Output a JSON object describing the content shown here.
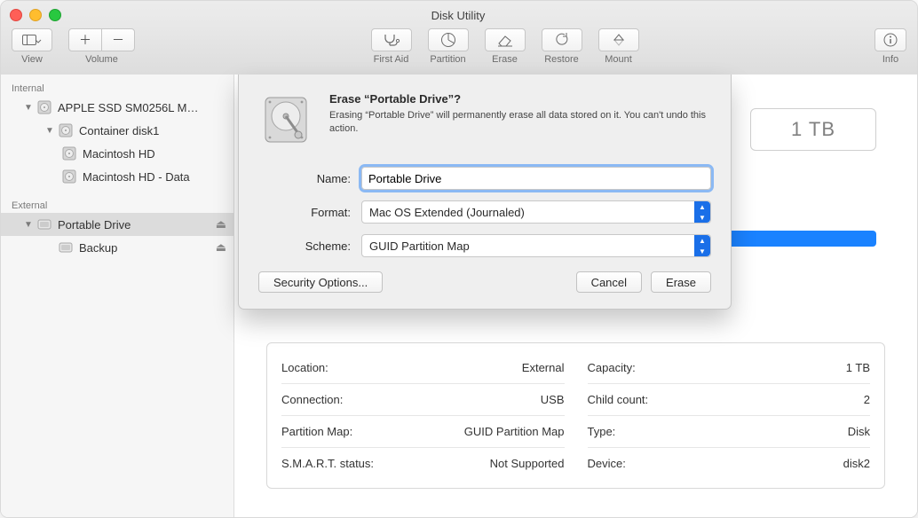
{
  "window": {
    "title": "Disk Utility"
  },
  "toolbar": {
    "view": "View",
    "volume": "Volume",
    "first_aid": "First Aid",
    "partition": "Partition",
    "erase": "Erase",
    "restore": "Restore",
    "mount": "Mount",
    "info": "Info"
  },
  "sidebar": {
    "internal_label": "Internal",
    "external_label": "External",
    "internal": {
      "disk": "APPLE SSD SM0256L M…",
      "container": "Container disk1",
      "vol1": "Macintosh HD",
      "vol2": "Macintosh HD - Data"
    },
    "external": {
      "disk": "Portable Drive",
      "vol1": "Backup"
    }
  },
  "main": {
    "capacity_badge": "1 TB",
    "info_left": [
      {
        "k": "Location:",
        "v": "External"
      },
      {
        "k": "Connection:",
        "v": "USB"
      },
      {
        "k": "Partition Map:",
        "v": "GUID Partition Map"
      },
      {
        "k": "S.M.A.R.T. status:",
        "v": "Not Supported"
      }
    ],
    "info_right": [
      {
        "k": "Capacity:",
        "v": "1 TB"
      },
      {
        "k": "Child count:",
        "v": "2"
      },
      {
        "k": "Type:",
        "v": "Disk"
      },
      {
        "k": "Device:",
        "v": "disk2"
      }
    ]
  },
  "dialog": {
    "title": "Erase “Portable Drive”?",
    "message": "Erasing “Portable Drive” will permanently erase all data stored on it. You can't undo this action.",
    "name_label": "Name:",
    "name_value": "Portable Drive",
    "format_label": "Format:",
    "format_value": "Mac OS Extended (Journaled)",
    "scheme_label": "Scheme:",
    "scheme_value": "GUID Partition Map",
    "security_btn": "Security Options...",
    "cancel_btn": "Cancel",
    "erase_btn": "Erase"
  }
}
